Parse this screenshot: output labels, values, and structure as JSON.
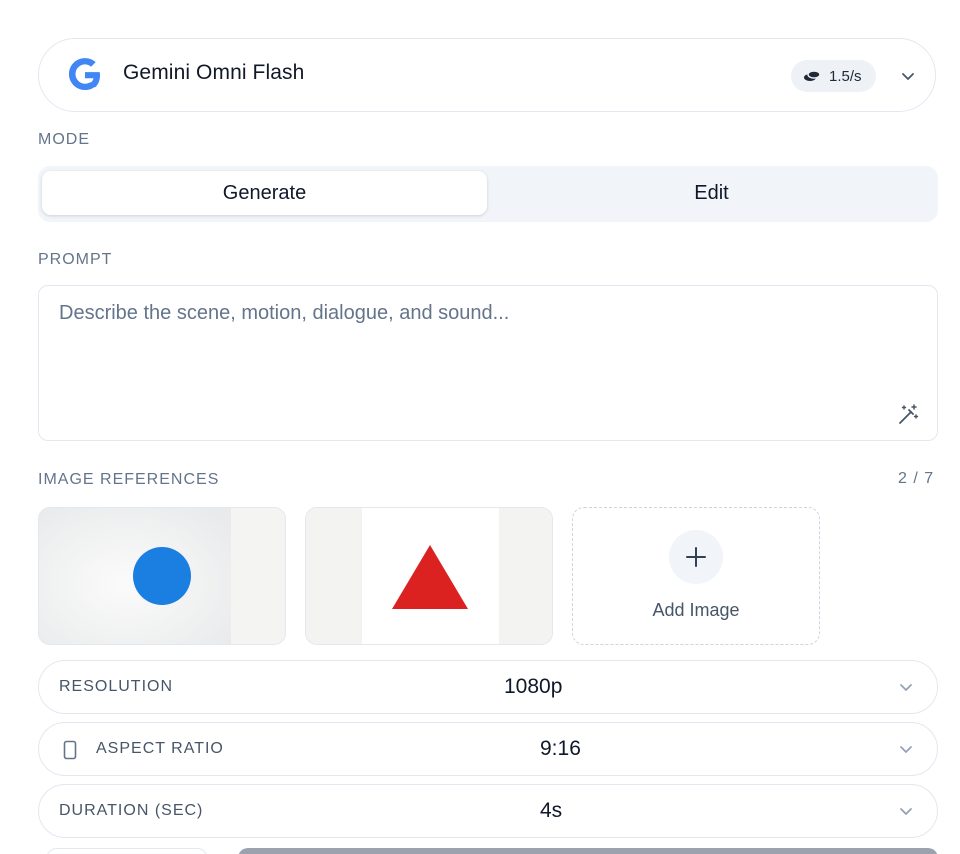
{
  "model": {
    "name": "Gemini Omni Flash",
    "rate": "1.5/s",
    "logo_icon": "google-g-logo",
    "rate_icon": "coins-icon"
  },
  "mode": {
    "label": "MODE",
    "tabs": [
      {
        "label": "Generate",
        "active": true
      },
      {
        "label": "Edit",
        "active": false
      }
    ]
  },
  "prompt": {
    "label": "PROMPT",
    "placeholder": "Describe the scene, motion, dialogue, and sound...",
    "value": "",
    "enhance_icon": "magic-wand-icon"
  },
  "image_references": {
    "label": "IMAGE REFERENCES",
    "count": "2 / 7",
    "images": [
      {
        "shape": "circle",
        "color": "#1a7fe0"
      },
      {
        "shape": "triangle",
        "color": "#dc2121"
      }
    ],
    "add_label": "Add Image"
  },
  "settings": {
    "resolution": {
      "label": "RESOLUTION",
      "value": "1080p"
    },
    "aspect_ratio": {
      "label": "ASPECT RATIO",
      "value": "9:16",
      "icon": "portrait-phone-icon"
    },
    "duration": {
      "label": "DURATION (SEC)",
      "value": "4s"
    }
  },
  "colors": {
    "google_blue": "#4285f4",
    "border": "#e2e8f0",
    "muted_text": "#64748b"
  }
}
